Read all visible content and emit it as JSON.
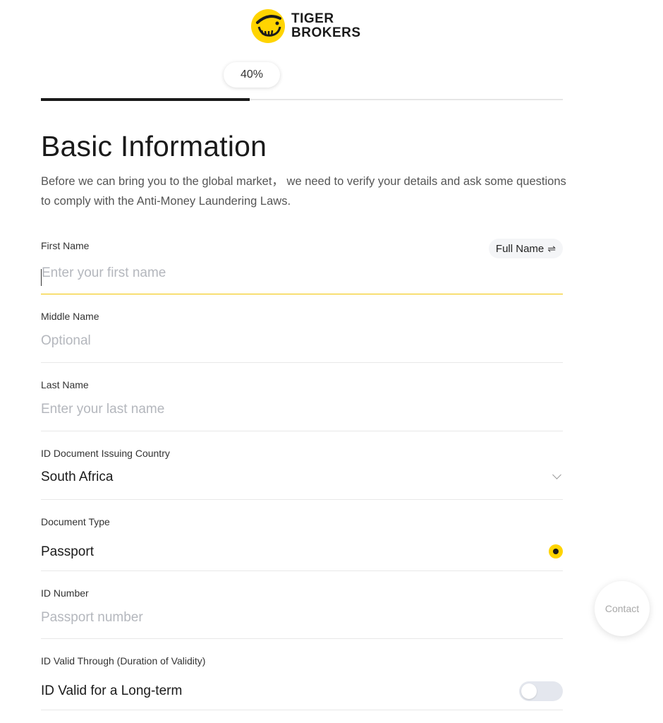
{
  "header": {
    "logo_line1": "TIGER",
    "logo_line2": "BROKERS",
    "brand_color": "#ffd400"
  },
  "progress": {
    "label": "40%",
    "value": 0.4
  },
  "title": "Basic Information",
  "description": "Before we can bring you to the global market， we need to verify your details and ask some questions to comply with the Anti-Money Laundering Laws.",
  "fields": {
    "first_name": {
      "label": "First Name",
      "placeholder": "Enter your first name",
      "toggle_label": "Full Name",
      "toggle_icon": "⇌"
    },
    "middle_name": {
      "label": "Middle Name",
      "placeholder": "Optional"
    },
    "last_name": {
      "label": "Last Name",
      "placeholder": "Enter your last name"
    },
    "issuing_country": {
      "label": "ID Document Issuing Country",
      "value": "South Africa"
    },
    "document_type": {
      "label": "Document Type",
      "value": "Passport",
      "selected": true
    },
    "id_number": {
      "label": "ID Number",
      "placeholder": "Passport number"
    },
    "id_valid_through": {
      "label": "ID Valid Through (Duration of Validity)",
      "value": "ID Valid for a Long-term",
      "toggle_on": false
    }
  },
  "contact": {
    "label": "Contact"
  },
  "colors": {
    "accent": "#ffd400",
    "active_underline": "#f2c500",
    "placeholder": "#b4b7bd"
  }
}
